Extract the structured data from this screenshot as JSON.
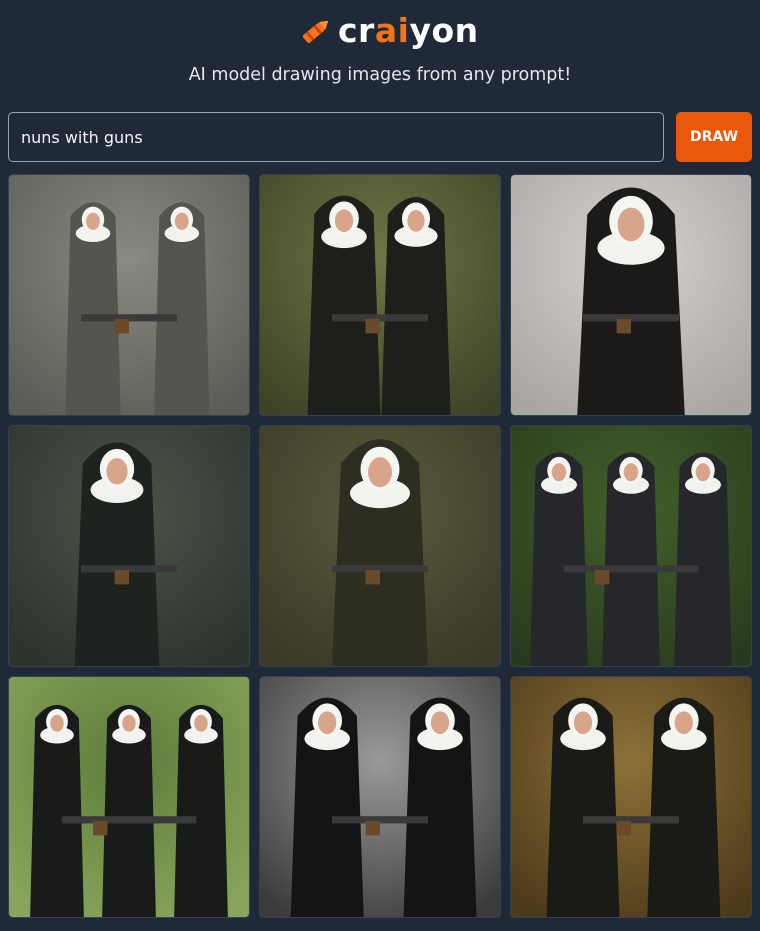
{
  "app": {
    "logo_prefix": "cr",
    "logo_accent": "ai",
    "logo_suffix": "yon",
    "tagline": "AI model drawing images from any prompt!",
    "accent_color": "#f97316",
    "background_color": "#1f2937"
  },
  "search": {
    "value": "nuns with guns",
    "draw_label": "DRAW",
    "draw_color": "#ea580c"
  },
  "results": [
    {
      "bg": "#8a8a82",
      "bg2": "#5c5c56",
      "robe": "#55554f",
      "nuns": [
        [
          0.35,
          0.72
        ],
        [
          0.72,
          0.72
        ]
      ],
      "gun": true
    },
    {
      "bg": "#6d7645",
      "bg2": "#3f4427",
      "robe": "#1d1f1a",
      "nuns": [
        [
          0.35,
          0.95
        ],
        [
          0.65,
          0.9
        ]
      ],
      "gun": true
    },
    {
      "bg": "#d4d2cf",
      "bg2": "#a9a6a2",
      "robe": "#1b1a19",
      "nuns": [
        [
          0.5,
          1.4
        ]
      ],
      "gun": true
    },
    {
      "bg": "#4c5449",
      "bg2": "#2d332d",
      "robe": "#1e231f",
      "nuns": [
        [
          0.45,
          1.1
        ]
      ],
      "gun": true
    },
    {
      "bg": "#5b5b3d",
      "bg2": "#3a3a26",
      "robe": "#2d2e21",
      "nuns": [
        [
          0.5,
          1.25
        ]
      ],
      "gun": true
    },
    {
      "bg": "#43602b",
      "bg2": "#2a3b1d",
      "robe": "#26272a",
      "nuns": [
        [
          0.2,
          0.75
        ],
        [
          0.5,
          0.75
        ],
        [
          0.8,
          0.75
        ]
      ],
      "gun": true
    },
    {
      "bg": "#5e7d3c",
      "bg2": "#8aa55b",
      "robe": "#191b1a",
      "nuns": [
        [
          0.2,
          0.7
        ],
        [
          0.5,
          0.7
        ],
        [
          0.8,
          0.7
        ]
      ],
      "gun": true
    },
    {
      "bg": "#9a9a9a",
      "bg2": "#3b3b3b",
      "robe": "#141414",
      "nuns": [
        [
          0.28,
          0.95
        ],
        [
          0.75,
          0.95
        ]
      ],
      "gun": true
    },
    {
      "bg": "#8c7138",
      "bg2": "#4d3a1a",
      "robe": "#1a1a17",
      "nuns": [
        [
          0.3,
          0.95
        ],
        [
          0.72,
          0.95
        ]
      ],
      "gun": true
    }
  ]
}
